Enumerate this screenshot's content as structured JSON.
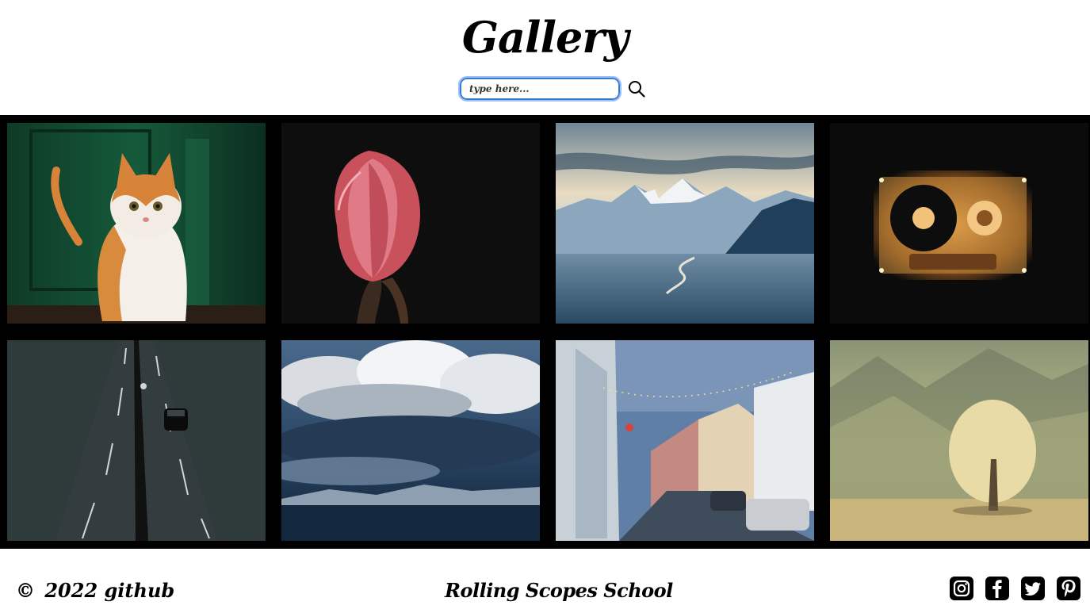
{
  "header": {
    "title": "Gallery",
    "search_placeholder": "type here..."
  },
  "gallery": {
    "images": [
      {
        "subject": "orange and white cat"
      },
      {
        "subject": "pink tulip"
      },
      {
        "subject": "snowy mountain valley"
      },
      {
        "subject": "glowing cassette tape"
      },
      {
        "subject": "road with car from above"
      },
      {
        "subject": "storm clouds over sea"
      },
      {
        "subject": "town street at dusk"
      },
      {
        "subject": "tree in misty field"
      }
    ]
  },
  "footer": {
    "copyright_symbol": "©",
    "year": "2022",
    "github_link": "github",
    "school": "Rolling Scopes School",
    "socials": [
      "instagram-icon",
      "facebook-icon",
      "twitter-icon",
      "pinterest-icon"
    ]
  }
}
